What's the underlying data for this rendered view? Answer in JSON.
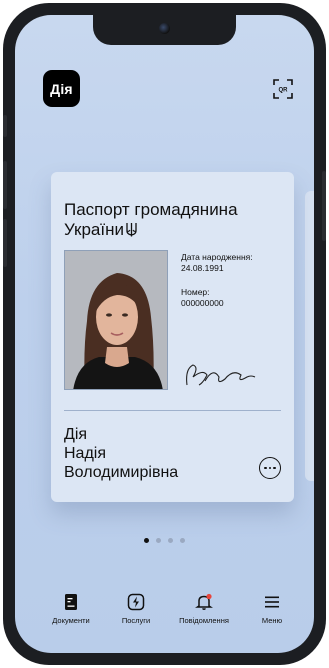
{
  "app": {
    "logo_text": "Дія",
    "accent": "#000000",
    "background": "#c2d4ee"
  },
  "header": {
    "qr_icon_label": "QR"
  },
  "card": {
    "title": "Паспорт громадянина України",
    "birth_label": "Дата народження:",
    "birth_value": "24.08.1991",
    "number_label": "Номер:",
    "number_value": "000000000",
    "name_lines": [
      "Дія",
      "Надія",
      "Володимирівна"
    ]
  },
  "pager": {
    "count": 4,
    "active_index": 0
  },
  "tabbar": {
    "items": [
      {
        "label": "Документи",
        "icon": "document-icon"
      },
      {
        "label": "Послуги",
        "icon": "lightning-icon"
      },
      {
        "label": "Повідомлення",
        "icon": "bell-icon"
      },
      {
        "label": "Меню",
        "icon": "menu-icon"
      }
    ]
  }
}
